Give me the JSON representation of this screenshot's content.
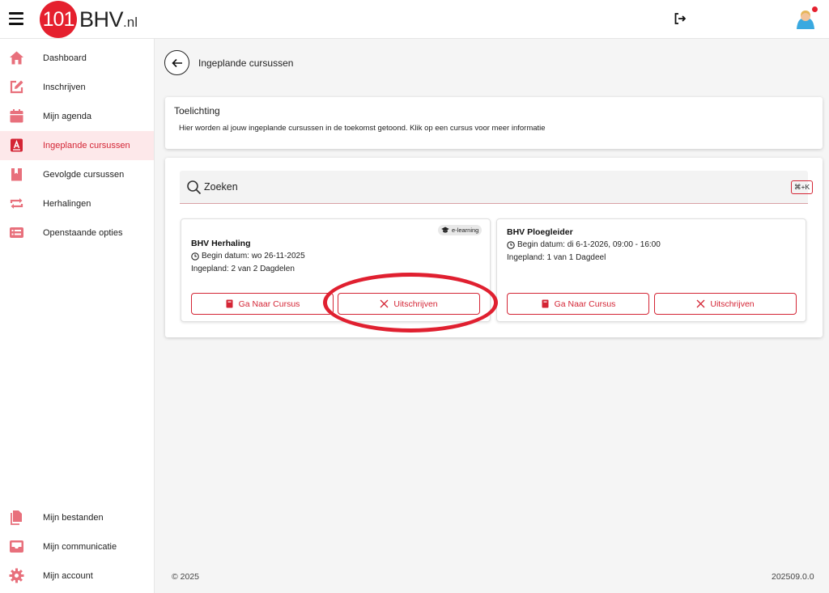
{
  "header": {
    "logo_number": "101",
    "logo_text": "BHV",
    "logo_suffix": ".nl"
  },
  "sidebar": {
    "items": [
      {
        "label": "Dashboard",
        "icon": "home-icon"
      },
      {
        "label": "Inschrijven",
        "icon": "edit-icon"
      },
      {
        "label": "Mijn agenda",
        "icon": "calendar-icon"
      },
      {
        "label": "Ingeplande cursussen",
        "icon": "planned-course-icon",
        "active": true
      },
      {
        "label": "Gevolgde cursussen",
        "icon": "completed-course-icon"
      },
      {
        "label": "Herhalingen",
        "icon": "repeat-icon"
      },
      {
        "label": "Openstaande opties",
        "icon": "list-icon"
      }
    ],
    "bottom_items": [
      {
        "label": "Mijn bestanden",
        "icon": "files-icon"
      },
      {
        "label": "Mijn communicatie",
        "icon": "inbox-icon"
      },
      {
        "label": "Mijn account",
        "icon": "gear-icon"
      }
    ]
  },
  "page": {
    "title": "Ingeplande cursussen"
  },
  "info": {
    "title": "Toelichting",
    "text": "Hier worden al jouw ingeplande cursussen in de toekomst getoond. Klik op een cursus voor meer informatie"
  },
  "search": {
    "placeholder": "Zoeken",
    "shortcut": "⌘+K"
  },
  "courses": [
    {
      "title": "BHV Herhaling",
      "badge": "e-learning",
      "begin": "Begin datum: wo 26-11-2025",
      "planned": "Ingepland: 2 van 2 Dagdelen",
      "go_label": "Ga Naar Cursus",
      "unsubscribe_label": "Uitschrijven"
    },
    {
      "title": "BHV Ploegleider",
      "begin": "Begin datum: di 6-1-2026, 09:00 - 16:00",
      "planned": "Ingepland: 1 van 1 Dagdeel",
      "go_label": "Ga Naar Cursus",
      "unsubscribe_label": "Uitschrijven"
    }
  ],
  "footer": {
    "copyright": "© 2025",
    "version": "202509.0.0"
  },
  "colors": {
    "accent": "#d42535",
    "icon": "#e8707c",
    "active_bg": "#fde8ea",
    "annotation": "#e02030"
  }
}
